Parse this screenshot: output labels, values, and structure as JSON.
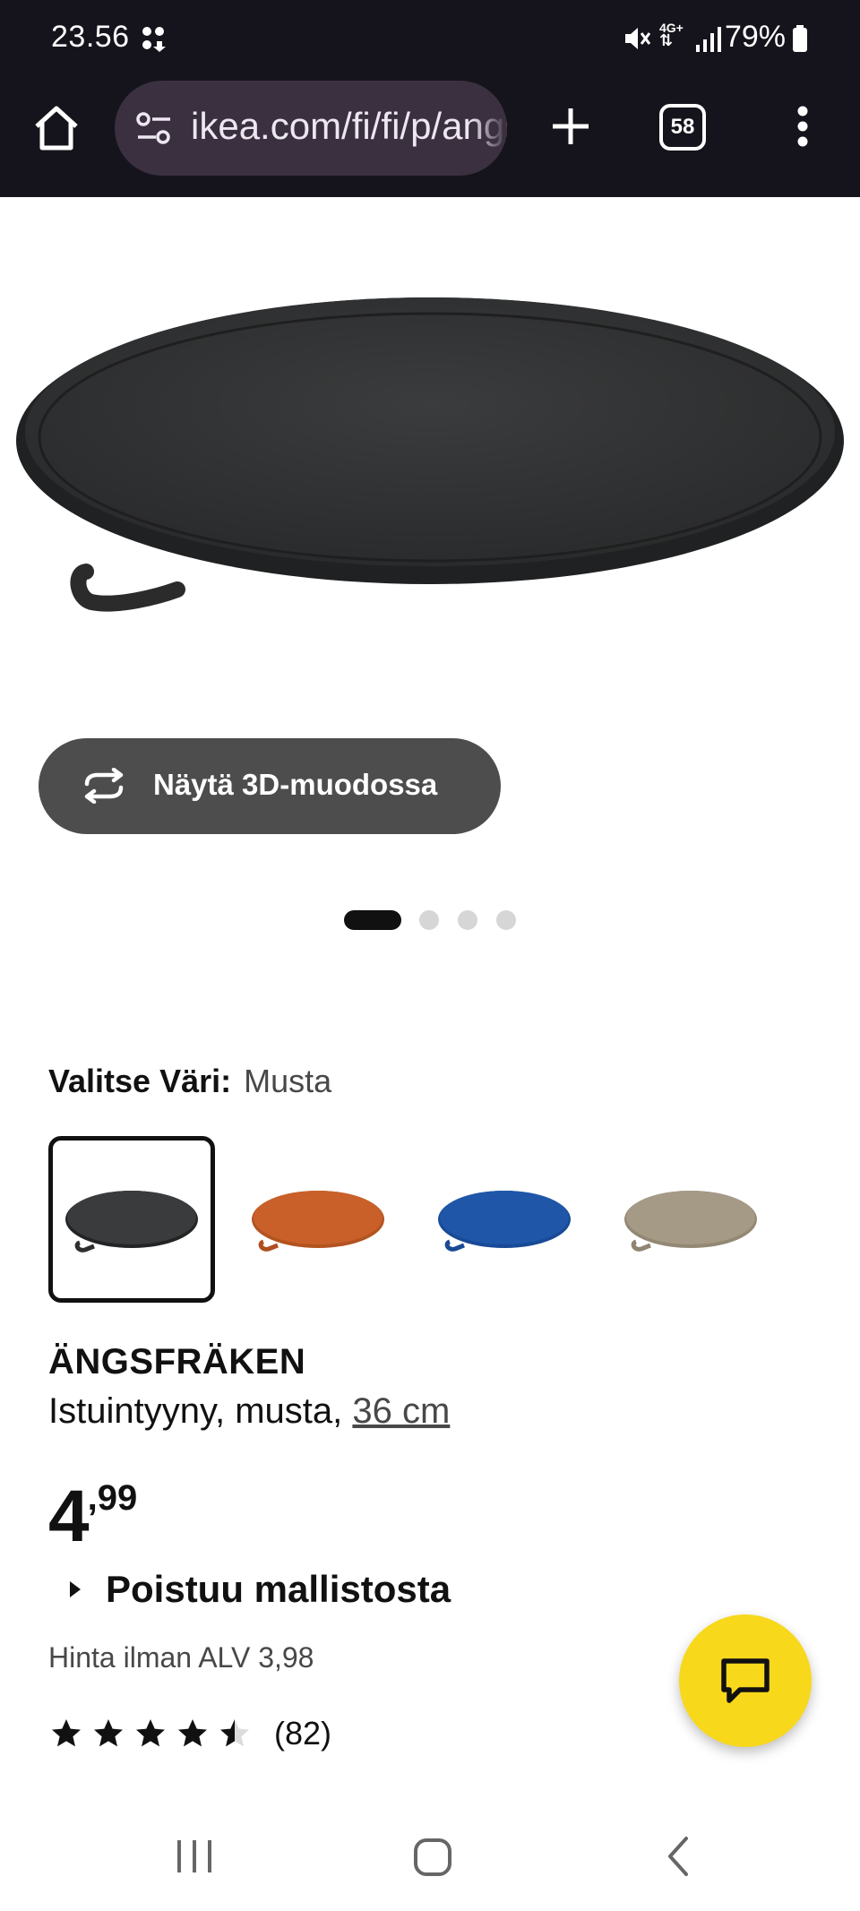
{
  "status_bar": {
    "time": "23.56",
    "battery": "79%",
    "network": "4G+",
    "icons": [
      "notification-dots-icon",
      "mute-icon",
      "network-icon",
      "signal-icon",
      "battery-icon"
    ]
  },
  "browser": {
    "url": "ikea.com/fi/fi/p/angsfraken",
    "tabs_count": "58",
    "icons": [
      "home-icon",
      "site-settings-icon",
      "new-tab-icon",
      "tabs-icon",
      "menu-icon"
    ]
  },
  "product": {
    "view_3d_label": "Näytä 3D-muodossa",
    "image_index": 0,
    "image_count": 4,
    "color_label": "Valitse Väri:",
    "color_value": "Musta",
    "swatches": [
      {
        "color": "#3a3b3c",
        "selected": true
      },
      {
        "color": "#c9602a",
        "selected": false
      },
      {
        "color": "#1f56a8",
        "selected": false
      },
      {
        "color": "#a59a86",
        "selected": false
      }
    ],
    "name": "ÄNGSFRÄKEN",
    "description": "Istuintyyny, musta,",
    "size": "36 cm",
    "price_int": "4",
    "price_dec": ",99",
    "status": "Poistuu mallistosta",
    "vat_text": "Hinta ilman ALV 3,98",
    "rating": 4.5,
    "rating_max": 5,
    "rating_count": "(82)"
  },
  "colors": {
    "accent_yellow": "#f8d81b",
    "browser_bar": "#15141c",
    "url_pill": "#3b3040"
  },
  "nav": {
    "icons": [
      "recent-apps-icon",
      "home-nav-icon",
      "back-icon"
    ]
  }
}
